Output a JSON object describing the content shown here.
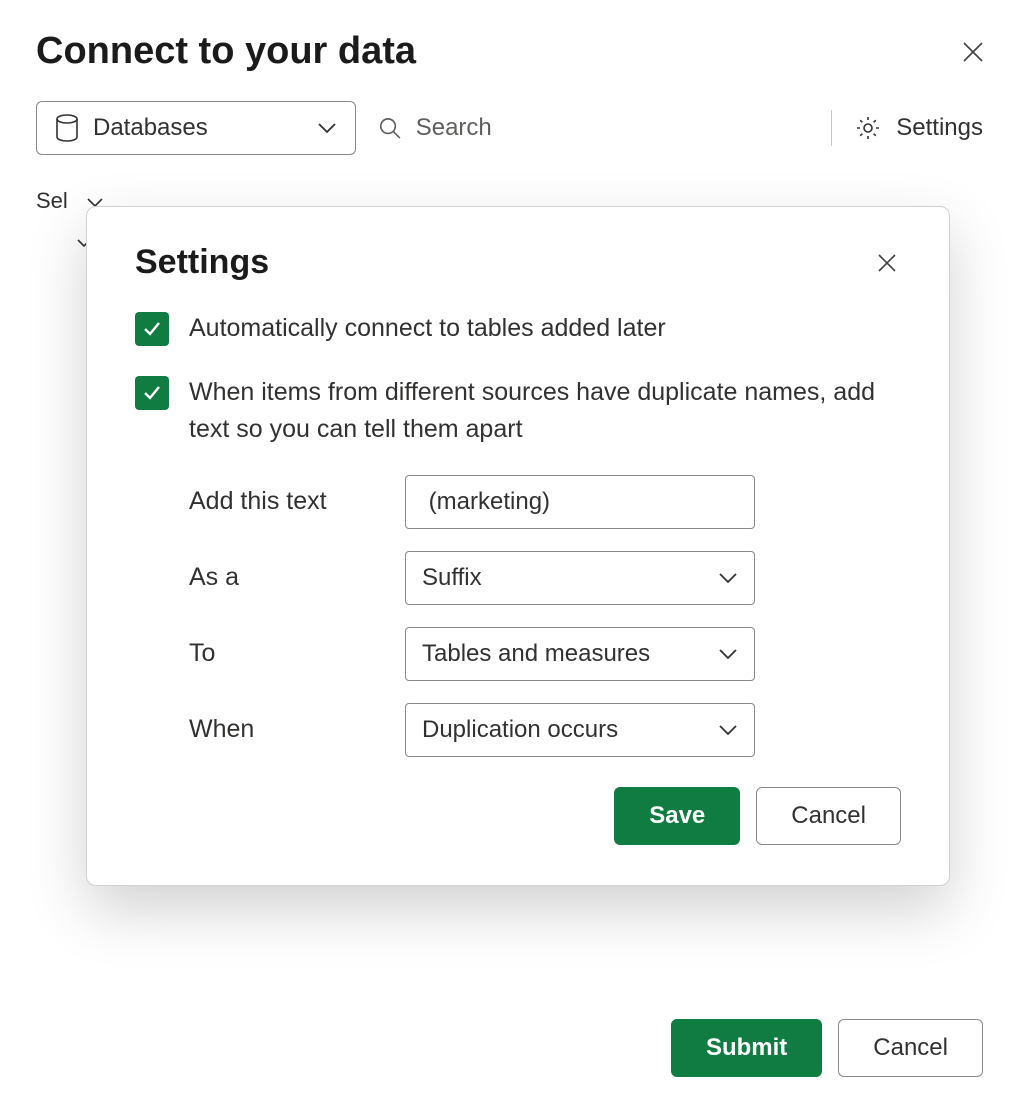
{
  "page": {
    "title": "Connect to your data",
    "section_label_partial": "Sel"
  },
  "toolbar": {
    "dropdown_label": "Databases",
    "search_placeholder": "Search",
    "settings_label": "Settings"
  },
  "footer": {
    "submit_label": "Submit",
    "cancel_label": "Cancel"
  },
  "modal": {
    "title": "Settings",
    "checkbox1_label": "Automatically connect to tables added later",
    "checkbox2_label": "When items from different sources have duplicate names, add text so you can tell them apart",
    "fields": {
      "add_text": {
        "label": "Add this text",
        "value": " (marketing)"
      },
      "as_a": {
        "label": "As a",
        "value": "Suffix"
      },
      "to": {
        "label": "To",
        "value": "Tables and measures"
      },
      "when": {
        "label": "When",
        "value": "Duplication occurs"
      }
    },
    "save_label": "Save",
    "cancel_label": "Cancel"
  }
}
